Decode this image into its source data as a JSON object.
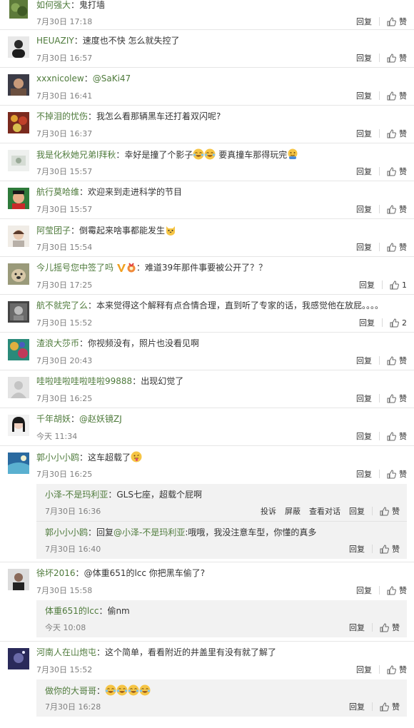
{
  "ui": {
    "reply_label": "回复",
    "like_label": "赞",
    "report_label": "投诉",
    "block_label": "屏蔽",
    "view_dialog_label": "查看对话"
  },
  "comments": [
    {
      "user": "如何强大",
      "text": "鬼打墙",
      "time": "7月30日 17:18",
      "likes": "赞"
    },
    {
      "user": "HEUAZIY",
      "text": "速度也不快 怎么就失控了",
      "time": "7月30日 16:57",
      "likes": "赞"
    },
    {
      "user": "xxxnicolew",
      "text": "@SaKi47",
      "time": "7月30日 16:41",
      "likes": "赞"
    },
    {
      "user": "不掉泪的忧伤",
      "text": "我怎么看那辆黑车还打着双闪呢?",
      "time": "7月30日 16:37",
      "likes": "赞"
    },
    {
      "user": "我是化秋她兄弟l拜秋",
      "text_a": "幸好是撞了个影子",
      "text_b": "  要真撞车那得玩完",
      "time": "7月30日 15:57",
      "likes": "赞"
    },
    {
      "user": "航行莫哈维",
      "text": "欢迎来到走进科学的节目",
      "time": "7月30日 15:57",
      "likes": "赞"
    },
    {
      "user": "阿莹团子",
      "text": "倒霉起来啥事都能发生",
      "time": "7月30日 15:54",
      "likes": "赞"
    },
    {
      "user": "今儿摇号您中签了吗",
      "text": "难道39年那件事要被公开了？？",
      "time": "7月30日 17:25",
      "likes": "1"
    },
    {
      "user": "航不就完了么",
      "text": "本来觉得这个解释有点合情合理，直到听了专家的话，我感觉他在放屁。。。。",
      "time": "7月30日 15:52",
      "likes": "2"
    },
    {
      "user": "渣浪大莎币",
      "text": "你视频没有，照片也没看见啊",
      "time": "7月30日 20:43",
      "likes": "赞"
    },
    {
      "user": "哇啦哇啦哇啦哇啦99888",
      "text": "出现幻觉了",
      "time": "7月30日 16:25",
      "likes": "赞"
    },
    {
      "user": "千年胡妖",
      "text": "@赵妖镜ZJ",
      "time": "今天 11:34",
      "likes": "赞"
    },
    {
      "user": "郭小小小鸥",
      "text": "这车超载了",
      "time": "7月30日 16:25",
      "likes": "赞"
    },
    {
      "user": "徐坏2016",
      "text": "@体重651的lcc 你把黑车偷了?",
      "time": "7月30日 15:58",
      "likes": "赞"
    },
    {
      "user": "河南人在山炮屯",
      "text": "这个简单，看看附近的井盖里有没有就了解了",
      "time": "7月30日 15:52",
      "likes": "赞"
    }
  ],
  "replies": [
    {
      "user": "小泽-不是玛利亚",
      "text": "GLS七座，超载个屁啊",
      "time": "7月30日 16:36",
      "likes": "赞"
    },
    {
      "user": "郭小小小鸥",
      "text_a": "回复",
      "mention": "@小泽-不是玛利亚",
      "text_b": ":哦哦，我没注意车型，你懂的真多",
      "time": "7月30日 16:40",
      "likes": "赞"
    },
    {
      "user": "体重651的lcc",
      "text": "偷nm",
      "time": "今天 10:08",
      "likes": "赞"
    },
    {
      "user": "做你的大哥哥",
      "text": "",
      "time": "7月30日 16:28",
      "likes": "赞"
    }
  ]
}
